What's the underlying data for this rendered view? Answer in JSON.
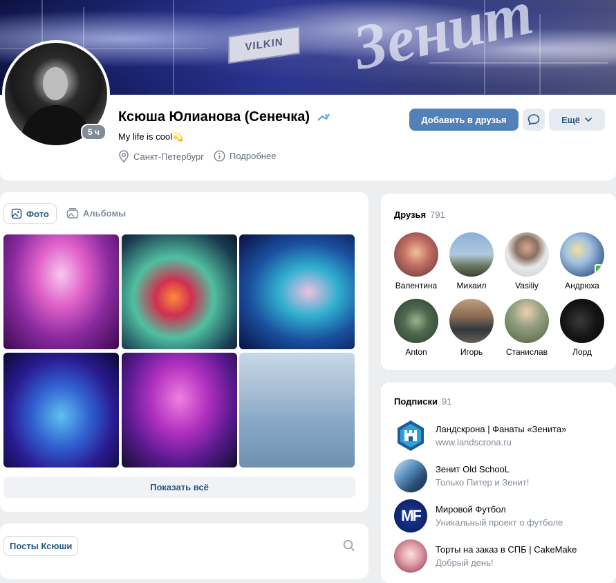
{
  "cover": {
    "sign_text": "VILKIN",
    "script_text": "Зенит"
  },
  "profile": {
    "name": "Ксюша Юлианова (Сенечка)",
    "status": "My life is cool💫",
    "last_seen_badge": "5 ч",
    "city": "Санкт-Петербург",
    "details_link": "Подробнее",
    "add_friend_button": "Добавить в друзья",
    "more_button": "Ещё"
  },
  "photos": {
    "tabs": [
      {
        "label": "Фото"
      },
      {
        "label": "Альбомы"
      }
    ],
    "show_all": "Показать всё"
  },
  "posts": {
    "tab_label": "Посты Ксюши"
  },
  "friends": {
    "title": "Друзья",
    "count": "791",
    "items": [
      {
        "name": "Валентина"
      },
      {
        "name": "Михаил"
      },
      {
        "name": "Vasiliy"
      },
      {
        "name": "Андрюха"
      },
      {
        "name": "Anton"
      },
      {
        "name": "Игорь"
      },
      {
        "name": "Станислав"
      },
      {
        "name": "Лорд"
      }
    ]
  },
  "subscriptions": {
    "title": "Подписки",
    "count": "91",
    "items": [
      {
        "title": "Ландскрона | Фанаты «Зенита»",
        "subtitle": "www.landscrona.ru"
      },
      {
        "title": "Зенит Old SchooL",
        "subtitle": "Только Питер и Зенит!"
      },
      {
        "title": "Мировой Футбол",
        "subtitle": "Уникальный проект о футболе",
        "logo_text": "MF"
      },
      {
        "title": "Торты на заказ в СПБ | CakeMake",
        "subtitle": "Добрый день!"
      }
    ]
  },
  "colors": {
    "accent": "#5181b8",
    "link": "#2a5885",
    "muted": "#818c99",
    "background": "#edeef0"
  }
}
